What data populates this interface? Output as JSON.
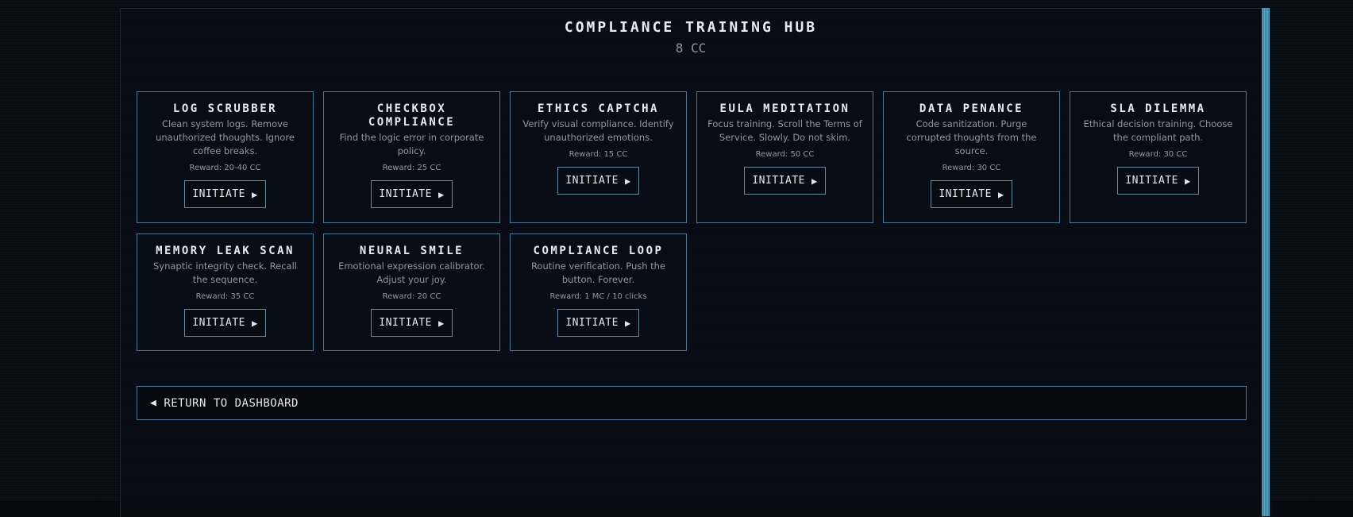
{
  "hub": {
    "title": "COMPLIANCE TRAINING HUB",
    "balance": "8 CC"
  },
  "cards": [
    {
      "title": "LOG SCRUBBER",
      "description": "Clean system logs. Remove unauthorized thoughts. Ignore coffee breaks.",
      "reward": "Reward: 20-40 CC",
      "button": "INITIATE"
    },
    {
      "title": "CHECKBOX COMPLIANCE",
      "description": "Find the logic error in corporate policy.",
      "reward": "Reward: 25 CC",
      "button": "INITIATE"
    },
    {
      "title": "ETHICS CAPTCHA",
      "description": "Verify visual compliance. Identify unauthorized emotions.",
      "reward": "Reward: 15 CC",
      "button": "INITIATE"
    },
    {
      "title": "EULA MEDITATION",
      "description": "Focus training. Scroll the Terms of Service. Slowly. Do not skim.",
      "reward": "Reward: 50 CC",
      "button": "INITIATE"
    },
    {
      "title": "DATA PENANCE",
      "description": "Code sanitization. Purge corrupted thoughts from the source.",
      "reward": "Reward: 30 CC",
      "button": "INITIATE"
    },
    {
      "title": "SLA DILEMMA",
      "description": "Ethical decision training. Choose the compliant path.",
      "reward": "Reward: 30 CC",
      "button": "INITIATE"
    },
    {
      "title": "MEMORY LEAK SCAN",
      "description": "Synaptic integrity check. Recall the sequence.",
      "reward": "Reward: 35 CC",
      "button": "INITIATE"
    },
    {
      "title": "NEURAL SMILE",
      "description": "Emotional expression calibrator. Adjust your joy.",
      "reward": "Reward: 20 CC",
      "button": "INITIATE"
    },
    {
      "title": "COMPLIANCE LOOP",
      "description": "Routine verification. Push the button. Forever.",
      "reward": "Reward: 1 MC / 10 clicks",
      "button": "INITIATE"
    }
  ],
  "footer": {
    "return_label": "RETURN TO DASHBOARD"
  },
  "icons": {
    "initiate": "play-arrow-icon",
    "return": "back-arrow-icon"
  },
  "colors": {
    "background": "#070b12",
    "border": "#4f7894",
    "scrollbar": "#4ea3c8",
    "text": "#e1e8ef",
    "muted": "#8e99a5"
  }
}
